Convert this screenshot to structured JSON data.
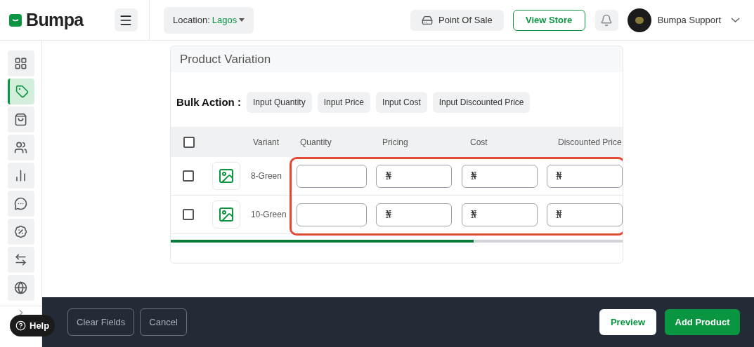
{
  "brand": {
    "name": "Bumpa"
  },
  "header": {
    "location_label": "Location:",
    "location_value": "Lagos",
    "point_of_sale": "Point Of Sale",
    "view_store": "View Store",
    "user_name": "Bumpa Support"
  },
  "sidebar": {
    "items": [
      {
        "selected": false
      },
      {
        "selected": true
      },
      {
        "selected": false
      },
      {
        "selected": false
      },
      {
        "selected": false
      },
      {
        "selected": false
      },
      {
        "selected": false
      },
      {
        "selected": false
      },
      {
        "selected": false
      }
    ]
  },
  "card": {
    "title": "Product Variation",
    "bulk_action_label": "Bulk Action :",
    "bulk_actions": [
      "Input Quantity",
      "Input Price",
      "Input Cost",
      "Input Discounted Price"
    ],
    "table": {
      "header_checked": false,
      "columns": [
        "Variant",
        "Quantity",
        "Pricing",
        "Cost",
        "Discounted Price"
      ],
      "rows": [
        {
          "checked": false,
          "variant": "8-Green",
          "pricing": "₦",
          "cost": "₦",
          "discounted_price": "₦"
        },
        {
          "checked": false,
          "variant": "10-Green",
          "pricing": "₦",
          "cost": "₦",
          "discounted_price": "₦"
        }
      ]
    }
  },
  "footer": {
    "clear_fields": "Clear Fields",
    "cancel": "Cancel",
    "preview": "Preview",
    "add_product": "Add Product"
  },
  "help": {
    "label": "Help"
  }
}
